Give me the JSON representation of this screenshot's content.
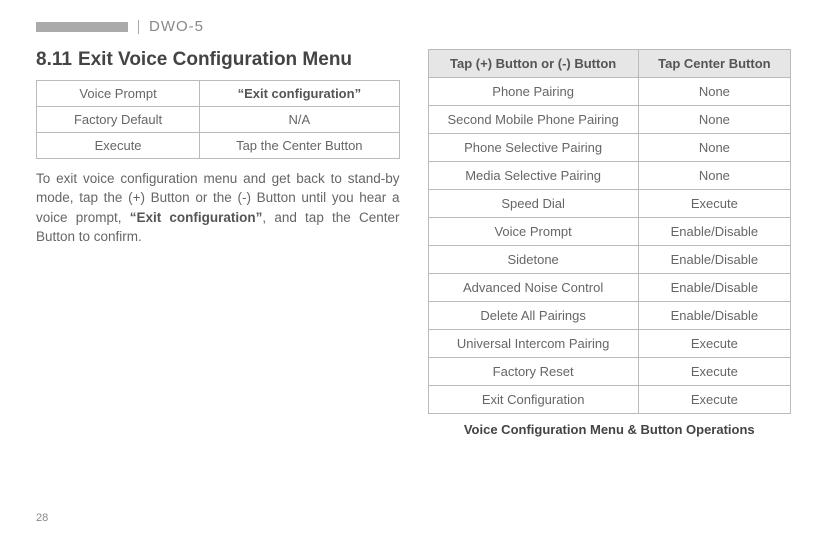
{
  "header": {
    "model": "DWO-5"
  },
  "left": {
    "section_num": "8.11",
    "section_title": "Exit Voice Configuration Menu",
    "table": {
      "rows": [
        {
          "label": "Voice Prompt",
          "value": "“Exit configuration”",
          "value_bold": true
        },
        {
          "label": "Factory Default",
          "value": "N/A",
          "value_bold": false
        },
        {
          "label": "Execute",
          "value": "Tap the Center Button",
          "value_bold": false
        }
      ]
    },
    "body_pre": "To exit voice configuration menu and get back to stand-by mode, tap the (+) Button or the (-) Button until you hear a voice prompt, ",
    "body_bold": "“Exit configuration”",
    "body_post": ", and tap the Center Button to confirm."
  },
  "right": {
    "headers": {
      "col1": "Tap (+) Button or (-) Button",
      "col2": "Tap Center Button"
    },
    "rows": [
      {
        "c1": "Phone Pairing",
        "c2": "None"
      },
      {
        "c1": "Second Mobile Phone Pairing",
        "c2": "None"
      },
      {
        "c1": "Phone Selective Pairing",
        "c2": "None"
      },
      {
        "c1": "Media Selective Pairing",
        "c2": "None"
      },
      {
        "c1": "Speed Dial",
        "c2": "Execute"
      },
      {
        "c1": "Voice Prompt",
        "c2": "Enable/Disable"
      },
      {
        "c1": "Sidetone",
        "c2": "Enable/Disable"
      },
      {
        "c1": "Advanced Noise Control",
        "c2": "Enable/Disable"
      },
      {
        "c1": "Delete All Pairings",
        "c2": "Enable/Disable"
      },
      {
        "c1": "Universal Intercom Pairing",
        "c2": "Execute"
      },
      {
        "c1": "Factory Reset",
        "c2": "Execute"
      },
      {
        "c1": "Exit Configuration",
        "c2": "Execute"
      }
    ],
    "caption": "Voice Configuration Menu & Button Operations"
  },
  "page_number": "28"
}
